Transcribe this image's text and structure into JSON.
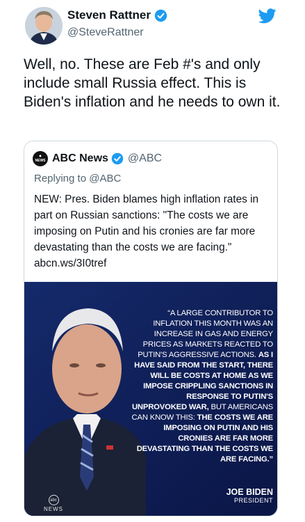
{
  "author": {
    "name": "Steven Rattner",
    "handle": "@SteveRattner",
    "verified": true
  },
  "tweet": {
    "text": "Well, no. These are Feb #'s and only include small Russia effect. This is Biden's inflation and he needs to own it."
  },
  "quoted": {
    "name": "ABC News",
    "handle": "@ABC",
    "verified": true,
    "logo_text": "NEWS",
    "replying": "Replying to @ABC",
    "text": "NEW: Pres. Biden blames high inflation rates in part on Russian sanctions: \"The costs we are imposing on Putin and his cronies are far more devastating than the costs we are facing.\" abcn.ws/3I0tref",
    "image": {
      "quote_regular_1": "“A large contributor to inflation this month was an increase in gas and energy prices as markets reacted to Putin's aggressive actions.",
      "quote_bold_1": "As I have said from the start, there will be costs at home as we impose crippling sanctions in response to Putin's unprovoked war,",
      "quote_regular_2": "but Americans can know this:",
      "quote_bold_2": "The costs we are imposing on Putin and his cronies are far more devastating than the costs we are facing.”",
      "attribution_name": "JOE BIDEN",
      "attribution_title": "PRESIDENT",
      "watermark_logo": "abc",
      "watermark_label": "NEWS"
    }
  },
  "colors": {
    "verified_blue": "#1d9bf0",
    "image_bg": "#0c1a4d",
    "handle_gray": "#536471"
  },
  "icons": [
    "verified-badge-icon",
    "twitter-bird-icon",
    "abc-news-logo"
  ]
}
